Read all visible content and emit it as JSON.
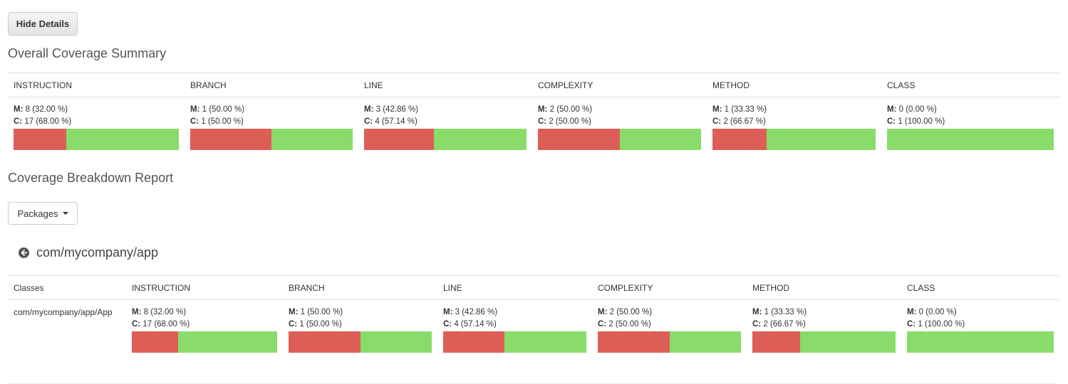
{
  "buttons": {
    "hide_details": "Hide Details",
    "packages": "Packages"
  },
  "headings": {
    "overall": "Overall Coverage Summary",
    "breakdown": "Coverage Breakdown Report"
  },
  "package": {
    "name": "com/mycompany/app"
  },
  "labels": {
    "missed": "M:",
    "covered": "C:"
  },
  "colors": {
    "missed": "#dd5e57",
    "covered": "#89dc6a"
  },
  "summary": {
    "columns": [
      "INSTRUCTION",
      "BRANCH",
      "LINE",
      "COMPLEXITY",
      "METHOD",
      "CLASS"
    ],
    "metrics": [
      {
        "missed": "8 (32.00 %)",
        "covered": "17 (68.00 %)",
        "missed_pct": 32.0
      },
      {
        "missed": "1 (50.00 %)",
        "covered": "1 (50.00 %)",
        "missed_pct": 50.0
      },
      {
        "missed": "3 (42.86 %)",
        "covered": "4 (57.14 %)",
        "missed_pct": 42.86
      },
      {
        "missed": "2 (50.00 %)",
        "covered": "2 (50.00 %)",
        "missed_pct": 50.0
      },
      {
        "missed": "1 (33.33 %)",
        "covered": "2 (66.67 %)",
        "missed_pct": 33.33
      },
      {
        "missed": "0 (0.00 %)",
        "covered": "1 (100.00 %)",
        "missed_pct": 0.0
      }
    ]
  },
  "breakdown": {
    "first_column": "Classes",
    "columns": [
      "INSTRUCTION",
      "BRANCH",
      "LINE",
      "COMPLEXITY",
      "METHOD",
      "CLASS"
    ],
    "rows": [
      {
        "class_name": "com/mycompany/app/App",
        "metrics": [
          {
            "missed": "8 (32.00 %)",
            "covered": "17 (68.00 %)",
            "missed_pct": 32.0
          },
          {
            "missed": "1 (50.00 %)",
            "covered": "1 (50.00 %)",
            "missed_pct": 50.0
          },
          {
            "missed": "3 (42.86 %)",
            "covered": "4 (57.14 %)",
            "missed_pct": 42.86
          },
          {
            "missed": "2 (50.00 %)",
            "covered": "2 (50.00 %)",
            "missed_pct": 50.0
          },
          {
            "missed": "1 (33.33 %)",
            "covered": "2 (66.67 %)",
            "missed_pct": 33.33
          },
          {
            "missed": "0 (0.00 %)",
            "covered": "1 (100.00 %)",
            "missed_pct": 0.0
          }
        ]
      }
    ]
  }
}
